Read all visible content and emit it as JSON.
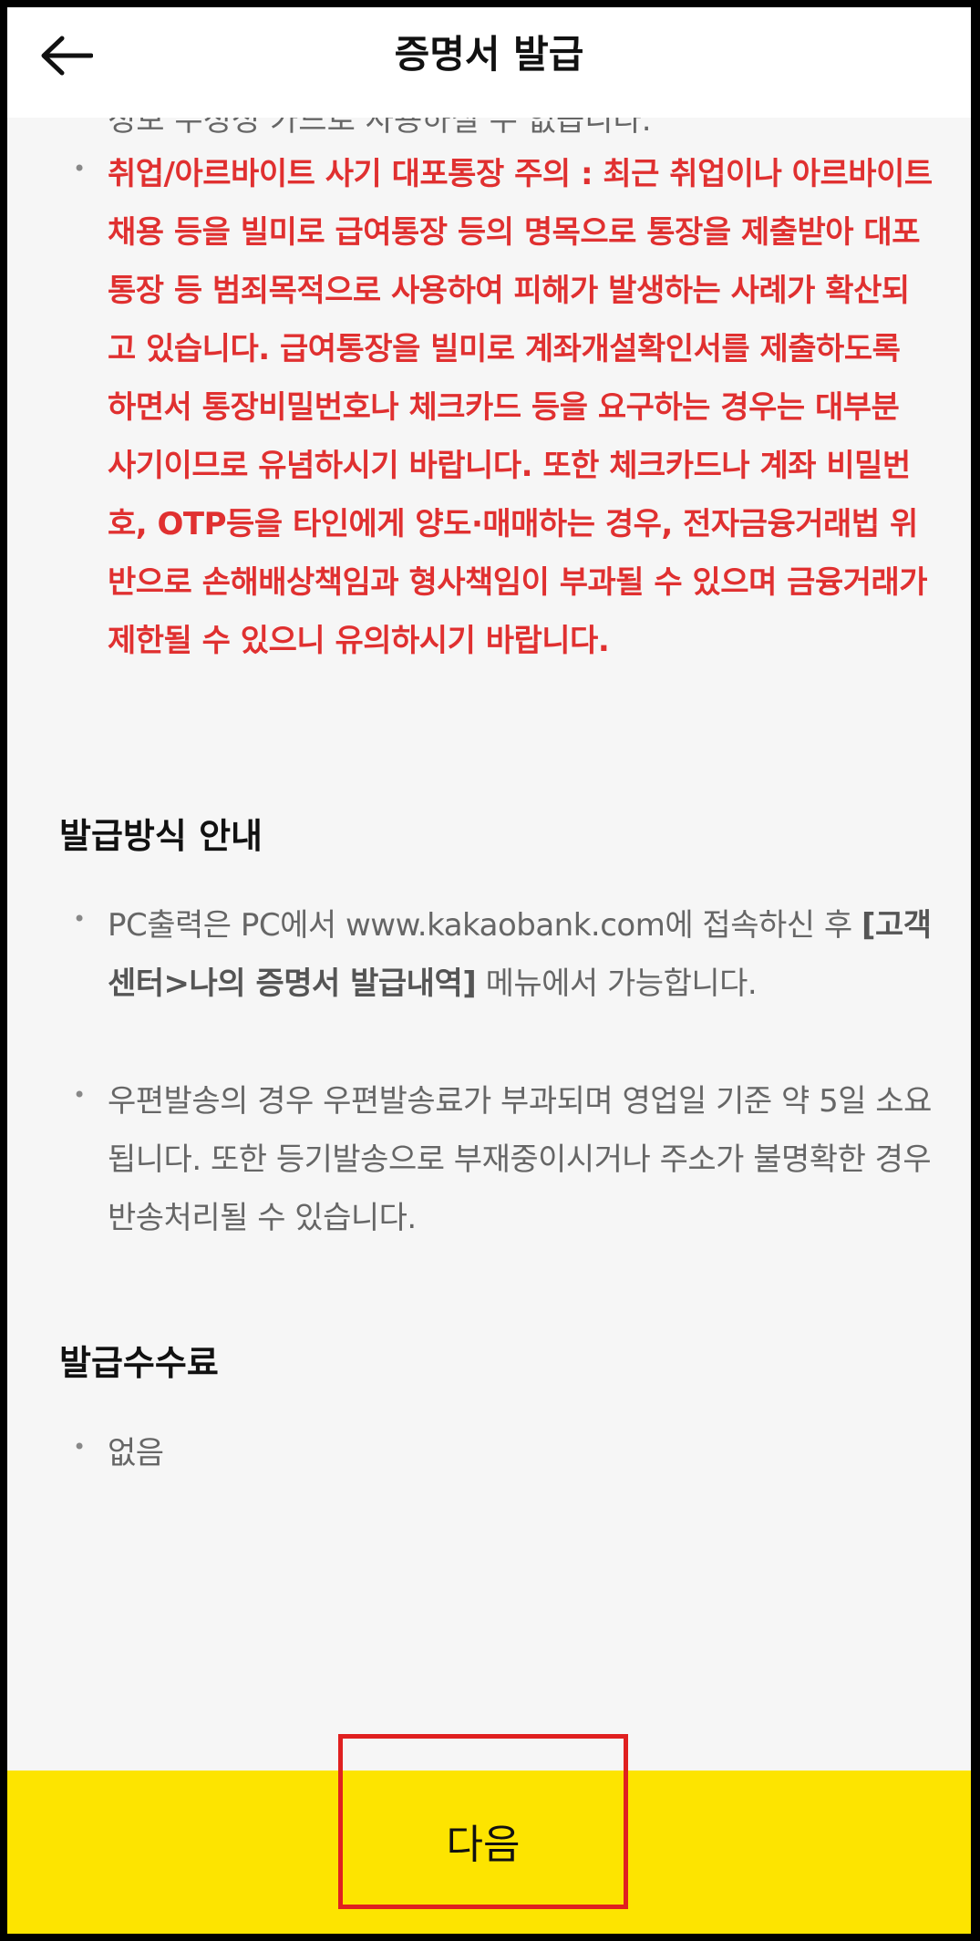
{
  "header": {
    "title": "증명서 발급",
    "back_icon": "arrow-left-icon"
  },
  "partial_line": "정보 수정성 카드로 사용하실 수 없습니다.",
  "warning": {
    "text": "취업/아르바이트 사기 대포통장 주의 : 최근 취업이나 아르바이트 채용 등을 빌미로 급여통장 등의 명목으로 통장을 제출받아 대포통장 등 범죄목적으로 사용하여 피해가 발생하는 사례가 확산되고 있습니다. 급여통장을 빌미로 계좌개설확인서를 제출하도록 하면서 통장비밀번호나 체크카드 등을 요구하는 경우는 대부분 사기이므로 유념하시기 바랍니다. 또한 체크카드나 계좌 비밀번호, OTP등을 타인에게 양도·매매하는 경우, 전자금융거래법 위반으로 손해배상책임과 형사책임이 부과될 수 있으며 금융거래가 제한될 수 있으니 유의하시기 바랍니다.",
    "color": "#e03030"
  },
  "issuance_method": {
    "title": "발급방식 안내",
    "item1_pre": "PC출력은 PC에서 www.kakaobank.com에 접속하신 후 ",
    "item1_bold": "[고객센터>나의 증명서 발급내역]",
    "item1_post": " 메뉴에서 가능합니다.",
    "item2": "우편발송의 경우 우편발송료가 부과되며 영업일 기준 약 5일 소요됩니다. 또한 등기발송으로 부재중이시거나 주소가 불명확한 경우 반송처리될 수 있습니다."
  },
  "fee": {
    "title": "발급수수료",
    "item": "없음"
  },
  "footer": {
    "next_label": "다음",
    "bar_color": "#fde400",
    "highlight_color": "#e02020"
  }
}
